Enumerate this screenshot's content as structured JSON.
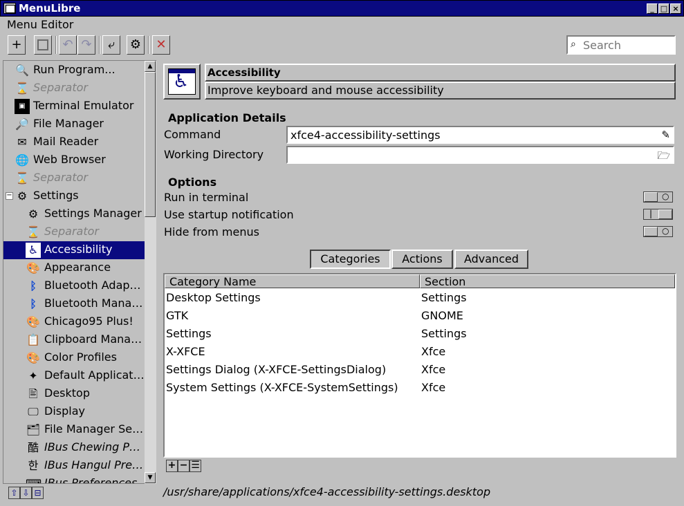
{
  "window": {
    "title": "MenuLibre"
  },
  "menubar": {
    "menu_editor": "Menu Editor"
  },
  "toolbar": {
    "add": "+",
    "save": "💾",
    "undo": "↶",
    "redo": "↷",
    "revert": "⤶",
    "execute": "⚙",
    "delete": "✕"
  },
  "search": {
    "placeholder": "Search"
  },
  "tree": {
    "items": [
      {
        "label": "Run Program...",
        "icon": "magnifier-icon"
      },
      {
        "label": "Separator",
        "icon": "hourglass-icon"
      },
      {
        "label": "Terminal Emulator",
        "icon": "terminal-icon"
      },
      {
        "label": "File Manager",
        "icon": "file-manager-icon"
      },
      {
        "label": "Mail Reader",
        "icon": "mail-icon"
      },
      {
        "label": "Web Browser",
        "icon": "globe-icon"
      },
      {
        "label": "Separator",
        "icon": "hourglass-icon"
      },
      {
        "label": "Settings",
        "icon": "settings-icon"
      },
      {
        "label": "Settings Manager",
        "icon": "settings-manager-icon"
      },
      {
        "label": "Separator",
        "icon": "hourglass-icon"
      },
      {
        "label": "Accessibility",
        "icon": "accessibility-icon"
      },
      {
        "label": "Appearance",
        "icon": "palette-icon"
      },
      {
        "label": "Bluetooth Adap…",
        "icon": "bluetooth-icon"
      },
      {
        "label": "Bluetooth Mana…",
        "icon": "bluetooth-icon"
      },
      {
        "label": "Chicago95 Plus!",
        "icon": "palette-icon"
      },
      {
        "label": "Clipboard Mana…",
        "icon": "clipboard-icon"
      },
      {
        "label": "Color Profiles",
        "icon": "palette-icon"
      },
      {
        "label": "Default Applicat…",
        "icon": "default-apps-icon"
      },
      {
        "label": "Desktop",
        "icon": "desktop-icon"
      },
      {
        "label": "Display",
        "icon": "display-icon"
      },
      {
        "label": "File Manager Se…",
        "icon": "file-manager-settings-icon"
      },
      {
        "label": "IBus Chewing P…",
        "icon": "ibus-chewing-icon"
      },
      {
        "label": "IBus Hangul Pre…",
        "icon": "ibus-hangul-icon"
      },
      {
        "label": "IBus Preferences",
        "icon": "ibus-icon"
      }
    ]
  },
  "tree_buttons": {
    "up": "⇧",
    "down": "⇩",
    "add_sub": "⊟"
  },
  "app": {
    "name": "Accessibility",
    "comment": "Improve keyboard and mouse accessibility"
  },
  "details": {
    "section": "Application Details",
    "command_label": "Command",
    "command_value": "xfce4-accessibility-settings",
    "workdir_label": "Working Directory",
    "workdir_value": ""
  },
  "options": {
    "section": "Options",
    "run_in_terminal": "Run in terminal",
    "startup_notification": "Use startup notification",
    "hide_from_menus": "Hide from menus"
  },
  "tabs": {
    "categories": "Categories",
    "actions": "Actions",
    "advanced": "Advanced"
  },
  "table": {
    "headers": {
      "name": "Category Name",
      "section": "Section"
    },
    "rows": [
      {
        "name": "Desktop Settings",
        "section": "Settings"
      },
      {
        "name": "GTK",
        "section": "GNOME"
      },
      {
        "name": "Settings",
        "section": "Settings"
      },
      {
        "name": "X-XFCE",
        "section": "Xfce"
      },
      {
        "name": "Settings Dialog (X-XFCE-SettingsDialog)",
        "section": "Xfce"
      },
      {
        "name": "System Settings (X-XFCE-SystemSettings)",
        "section": "Xfce"
      }
    ]
  },
  "table_buttons": {
    "add": "+",
    "remove": "−",
    "edit": "☰"
  },
  "status": {
    "path": "/usr/share/applications/xfce4-accessibility-settings.desktop"
  },
  "colors": {
    "titlebar": "#0a0a80",
    "selection": "#0a0a80",
    "face": "#c0c0c0"
  }
}
